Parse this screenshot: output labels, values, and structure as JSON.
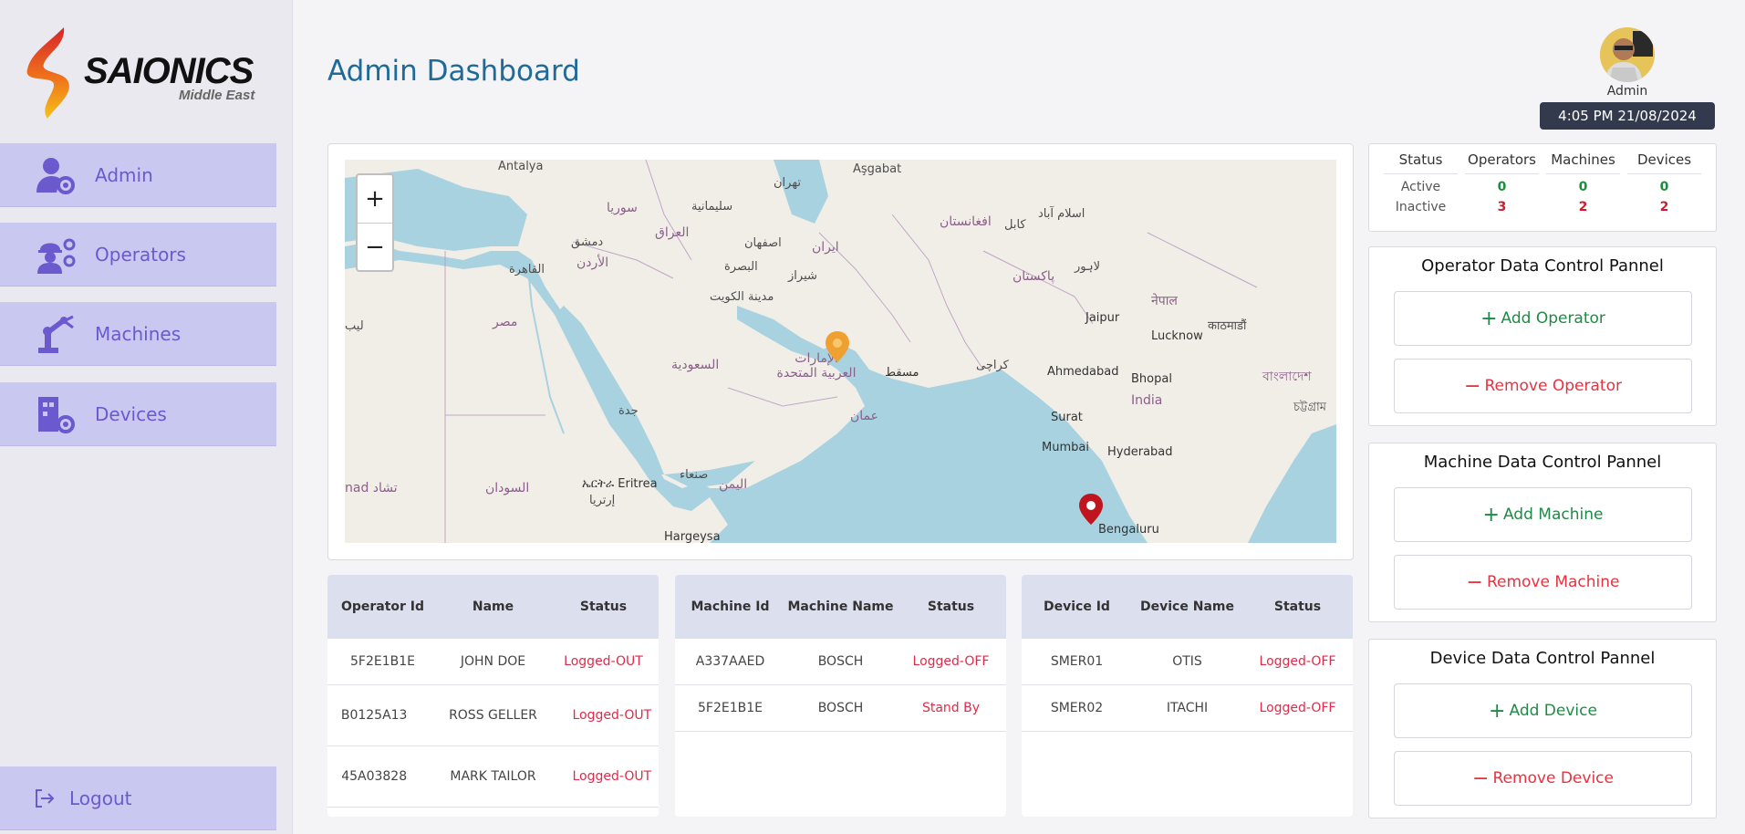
{
  "brand": {
    "name": "SAIONICS",
    "subtitle": "Middle East"
  },
  "sidebar": {
    "items": [
      {
        "label": "Admin",
        "icon": "user-gear-icon"
      },
      {
        "label": "Operators",
        "icon": "worker-gear-icon"
      },
      {
        "label": "Machines",
        "icon": "robot-arm-icon"
      },
      {
        "label": "Devices",
        "icon": "device-gear-icon"
      }
    ],
    "logout_label": "Logout"
  },
  "header": {
    "title": "Admin Dashboard",
    "user_name": "Admin",
    "clock": "4:05 PM  21/08/2024"
  },
  "map": {
    "zoom_in": "+",
    "zoom_out": "−",
    "labels": {
      "antalya": "Antalya",
      "asgabat": "Aşgabat",
      "tehran": "تهران",
      "soria": "سوريا",
      "sulaymaniyah": "سليمانية",
      "iraq": "العراق",
      "dimashq": "دمشق",
      "isfahan": "اصفهان",
      "iran": "ايران",
      "afghanistan": "افغانستان",
      "kabul": "كابل",
      "islamabad": "اسلام آباد",
      "alurdun": "الأردن",
      "qahira": "القاهرة",
      "basra": "البصرة",
      "shiraz": "شیراز",
      "lahore": "لاہور",
      "pakistan": "پاکستان",
      "nepal": "नेपाल",
      "kuwait": "مدينة الكويت",
      "misr": "مصر",
      "jaipur": "Jaipur",
      "lucknow": "Lucknow",
      "kathmandu": "काठमाडौं",
      "saudi": "السعودية",
      "uae": "الإمارات العربية المتحدة",
      "muscat": "مسقط",
      "karachi": "کراچی",
      "ahmedabad": "Ahmedabad",
      "bhopal": "Bhopal",
      "india": "India",
      "bangladesh": "বাংলাদেশ",
      "chittagong": "চট্টগ্রাম",
      "jeddah": "جدة",
      "oman": "عمان",
      "surat": "Surat",
      "mumbai": "Mumbai",
      "hyderabad": "Hyderabad",
      "chad": "nad تشاد",
      "sudan": "السودان",
      "eritrea": "ኤርትራ Eritrea",
      "eritrea_ar": "إرتريا",
      "sanaa": "صنعاء",
      "yemen": "اليمن",
      "bengaluru": "Bengaluru",
      "hargeysa": "Hargeysa",
      "libya": "ليب"
    },
    "markers": [
      {
        "name": "UAE",
        "color": "#f0a030"
      },
      {
        "name": "Bengaluru",
        "color": "#c0141e"
      }
    ]
  },
  "operators_table": {
    "headers": [
      "Operator Id",
      "Name",
      "Status"
    ],
    "rows": [
      {
        "id": "5F2E1B1E",
        "name": "JOHN DOE",
        "status": "Logged-OUT"
      },
      {
        "id": "B0125A13",
        "name": "ROSS GELLER",
        "status": "Logged-OUT"
      },
      {
        "id": "45A03828",
        "name": "MARK TAILOR",
        "status": "Logged-OUT"
      }
    ]
  },
  "machines_table": {
    "headers": [
      "Machine Id",
      "Machine Name",
      "Status"
    ],
    "rows": [
      {
        "id": "A337AAED",
        "name": "BOSCH",
        "status": "Logged-OFF"
      },
      {
        "id": "5F2E1B1E",
        "name": "BOSCH",
        "status": "Stand By"
      }
    ]
  },
  "devices_table": {
    "headers": [
      "Device Id",
      "Device Name",
      "Status"
    ],
    "rows": [
      {
        "id": "SMER01",
        "name": "OTIS",
        "status": "Logged-OFF"
      },
      {
        "id": "SMER02",
        "name": "ITACHI",
        "status": "Logged-OFF"
      }
    ]
  },
  "status_summary": {
    "headers": [
      "Status",
      "Operators",
      "Machines",
      "Devices"
    ],
    "active": {
      "label": "Active",
      "operators": "0",
      "machines": "0",
      "devices": "0"
    },
    "inactive": {
      "label": "Inactive",
      "operators": "3",
      "machines": "2",
      "devices": "2"
    }
  },
  "panels": {
    "operator": {
      "title": "Operator Data Control Pannel",
      "add": "Add Operator",
      "remove": "Remove Operator"
    },
    "machine": {
      "title": "Machine Data Control Pannel",
      "add": "Add Machine",
      "remove": "Remove Machine"
    },
    "device": {
      "title": "Device Data Control Pannel",
      "add": "Add Device",
      "remove": "Remove Device"
    }
  },
  "colors": {
    "accent": "#6a5acd",
    "title": "#1f6a98",
    "active": "#1a8f3a",
    "inactive": "#d21a2e"
  }
}
